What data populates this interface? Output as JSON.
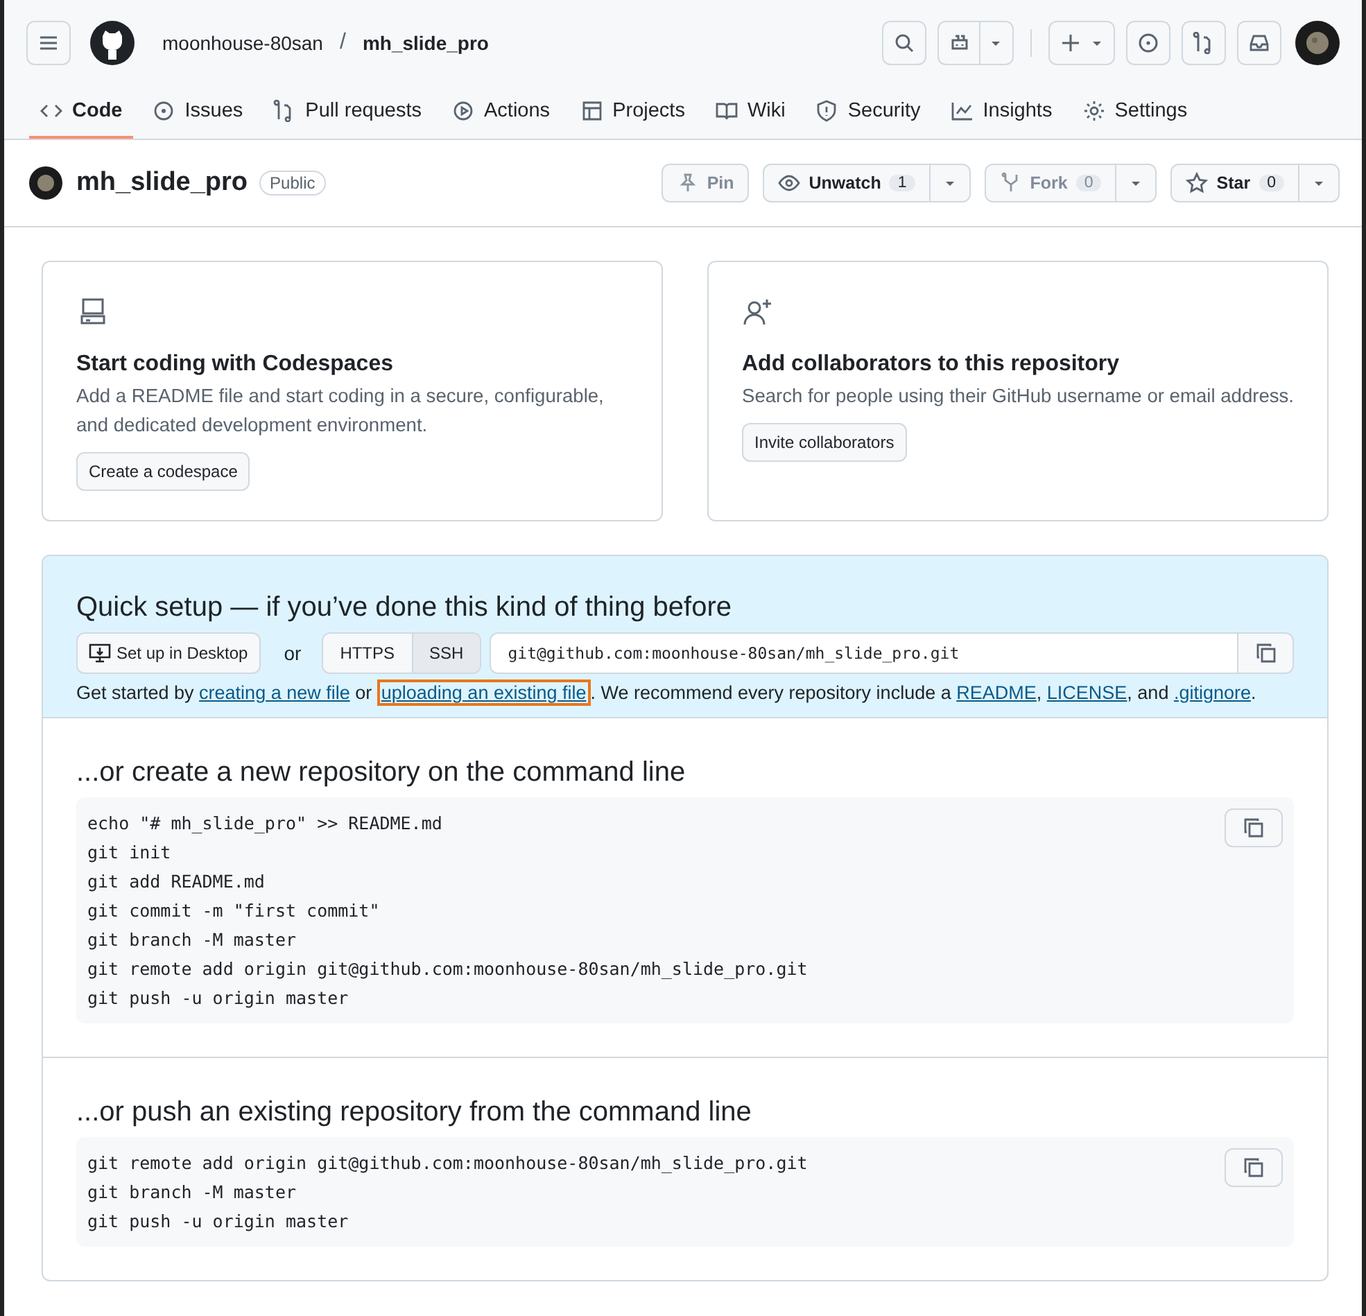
{
  "header": {
    "owner": "moonhouse-80san",
    "separator": "/",
    "repo": "mh_slide_pro"
  },
  "tabs": [
    {
      "label": "Code",
      "selected": true
    },
    {
      "label": "Issues",
      "selected": false
    },
    {
      "label": "Pull requests",
      "selected": false
    },
    {
      "label": "Actions",
      "selected": false
    },
    {
      "label": "Projects",
      "selected": false
    },
    {
      "label": "Wiki",
      "selected": false
    },
    {
      "label": "Security",
      "selected": false
    },
    {
      "label": "Insights",
      "selected": false
    },
    {
      "label": "Settings",
      "selected": false
    }
  ],
  "repo_header": {
    "name": "mh_slide_pro",
    "visibility": "Public",
    "actions": [
      {
        "label": "Pin",
        "menu": false,
        "disabled": true
      },
      {
        "label": "Unwatch",
        "count": "1",
        "menu": true,
        "disabled": false
      },
      {
        "label": "Fork",
        "count": "0",
        "menu": true,
        "disabled": true
      },
      {
        "label": "Star",
        "count": "0",
        "menu": true,
        "disabled": false
      }
    ]
  },
  "cards": [
    {
      "title": "Start coding with Codespaces",
      "text": "Add a README file and start coding in a secure, configurable, and dedicated development environment.",
      "button": "Create a codespace"
    },
    {
      "title": "Add collaborators to this repository",
      "text": "Search for people using their GitHub username or email address.",
      "button": "Invite collaborators"
    }
  ],
  "quick_setup": {
    "title": "Quick setup — if you’ve done this kind of thing before",
    "desktop_button": "Set up in Desktop",
    "or": "or",
    "protocols": [
      {
        "label": "HTTPS",
        "selected": false
      },
      {
        "label": "SSH",
        "selected": true
      }
    ],
    "url": "git@github.com:moonhouse-80san/mh_slide_pro.git",
    "hint": [
      {
        "text": "Get started by ",
        "kind": "text"
      },
      {
        "text": "creating a new file",
        "kind": "link",
        "highlighted": false
      },
      {
        "text": " or ",
        "kind": "text"
      },
      {
        "text": "uploading an existing file",
        "kind": "link",
        "highlighted": true
      },
      {
        "text": ". We recommend every repository include a ",
        "kind": "text"
      },
      {
        "text": "README",
        "kind": "link",
        "highlighted": false
      },
      {
        "text": ", ",
        "kind": "text"
      },
      {
        "text": "LICENSE",
        "kind": "link",
        "highlighted": false
      },
      {
        "text": ", and ",
        "kind": "text"
      },
      {
        "text": ".gitignore",
        "kind": "link",
        "highlighted": false
      },
      {
        "text": ".",
        "kind": "text"
      }
    ]
  },
  "sections": [
    {
      "title": "...or create a new repository on the command line",
      "lines": [
        "echo \"# mh_slide_pro\" >> README.md",
        "git init",
        "git add README.md",
        "git commit -m \"first commit\"",
        "git branch -M master",
        "git remote add origin git@github.com:moonhouse-80san/mh_slide_pro.git",
        "git push -u origin master"
      ]
    },
    {
      "title": "...or push an existing repository from the command line",
      "lines": [
        "git remote add origin git@github.com:moonhouse-80san/mh_slide_pro.git",
        "git branch -M master",
        "git push -u origin master"
      ]
    }
  ]
}
